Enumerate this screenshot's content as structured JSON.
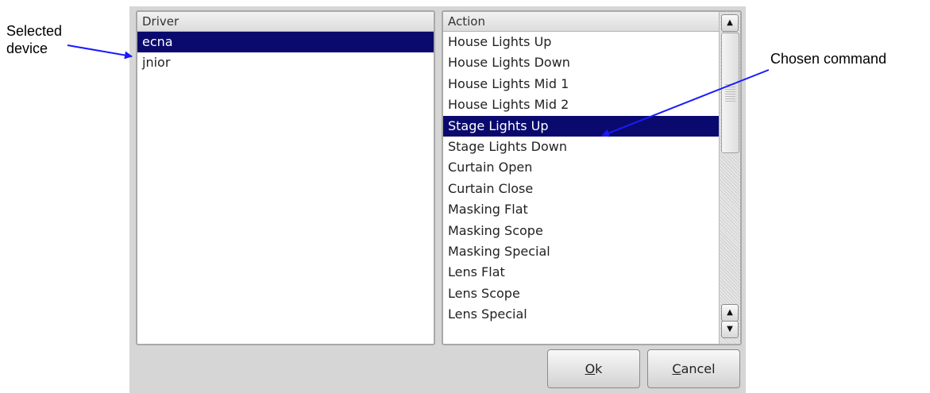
{
  "annotations": {
    "selected_device_line1": "Selected",
    "selected_device_line2": "device",
    "chosen_command": "Chosen command"
  },
  "driver_panel": {
    "header": "Driver",
    "items": [
      "ecna",
      "jnior"
    ],
    "selected": "ecna"
  },
  "action_panel": {
    "header": "Action",
    "items": [
      "House Lights Up",
      "House Lights Down",
      "House Lights Mid 1",
      "House Lights Mid 2",
      "Stage Lights Up",
      "Stage Lights Down",
      "Curtain Open",
      "Curtain Close",
      "Masking Flat",
      "Masking Scope",
      "Masking Special",
      "Lens Flat",
      "Lens Scope",
      "Lens Special"
    ],
    "selected": "Stage Lights Up"
  },
  "buttons": {
    "ok_mnemonic": "O",
    "ok_rest": "k",
    "cancel_mnemonic": "C",
    "cancel_rest": "ancel"
  },
  "colors": {
    "selection": "#0a0a6e",
    "arrow": "#1a1aff",
    "dialog_bg": "#d6d6d6"
  }
}
